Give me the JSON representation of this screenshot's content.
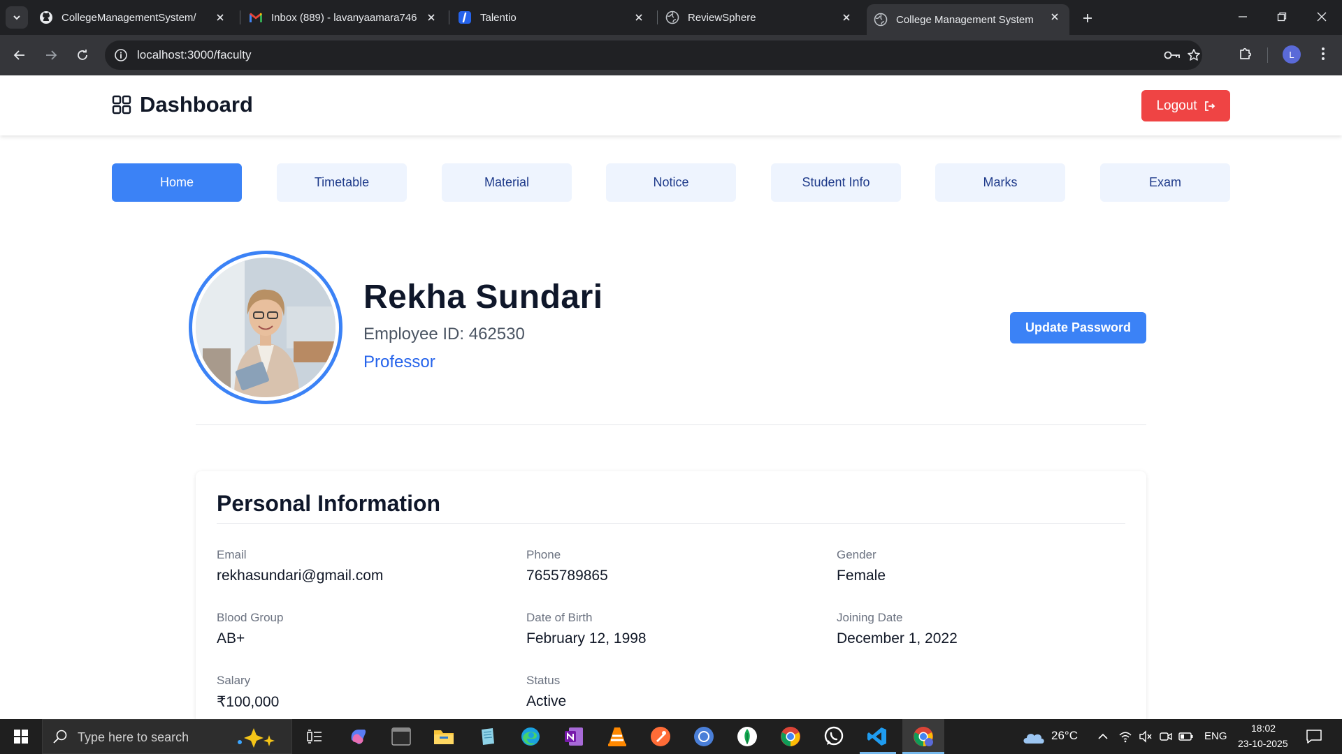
{
  "browser": {
    "tabs": [
      {
        "title": "CollegeManagementSystem/",
        "favicon": "github-icon"
      },
      {
        "title": "Inbox (889) - lavanyaamara746",
        "favicon": "gmail-icon"
      },
      {
        "title": "Talentio",
        "favicon": "talentio-icon"
      },
      {
        "title": "ReviewSphere",
        "favicon": "globe-icon"
      },
      {
        "title": "College Management System",
        "favicon": "globe-icon",
        "active": true
      }
    ],
    "url": "localhost:3000/faculty",
    "profile_initial": "L"
  },
  "header": {
    "title": "Dashboard",
    "logout_label": "Logout"
  },
  "nav": {
    "tabs": [
      {
        "label": "Home",
        "active": true
      },
      {
        "label": "Timetable"
      },
      {
        "label": "Material"
      },
      {
        "label": "Notice"
      },
      {
        "label": "Student Info"
      },
      {
        "label": "Marks"
      },
      {
        "label": "Exam"
      }
    ]
  },
  "profile": {
    "name": "Rekha Sundari",
    "employee_id": "Employee ID: 462530",
    "role": "Professor",
    "update_password_label": "Update Password"
  },
  "personal_info": {
    "title": "Personal Information",
    "fields": [
      {
        "label": "Email",
        "value": "rekhasundari@gmail.com"
      },
      {
        "label": "Phone",
        "value": "7655789865"
      },
      {
        "label": "Gender",
        "value": "Female"
      },
      {
        "label": "Blood Group",
        "value": "AB+"
      },
      {
        "label": "Date of Birth",
        "value": "February 12, 1998"
      },
      {
        "label": "Joining Date",
        "value": "December 1, 2022"
      },
      {
        "label": "Salary",
        "value": "₹100,000"
      },
      {
        "label": "Status",
        "value": "Active"
      }
    ]
  },
  "taskbar": {
    "search_placeholder": "Type here to search",
    "weather": "26°C",
    "language": "ENG",
    "time": "18:02",
    "date": "23-10-2025"
  },
  "colors": {
    "primary": "#3b82f6",
    "logout": "#ef4444",
    "role": "#2563eb"
  }
}
